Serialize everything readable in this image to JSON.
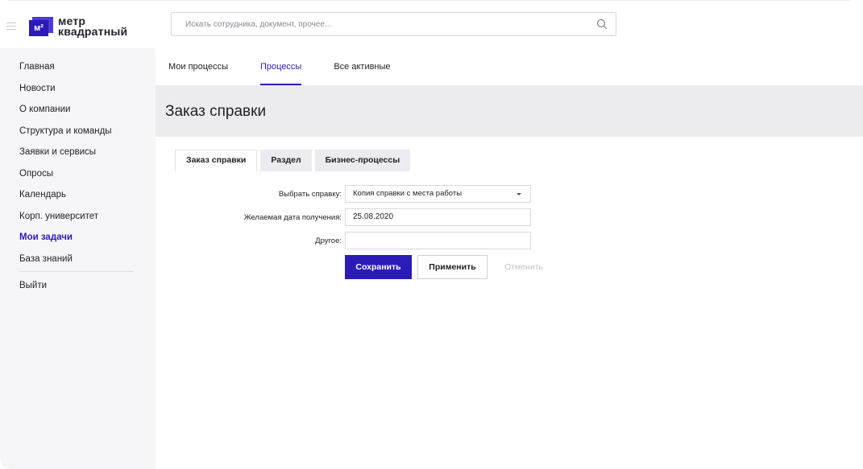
{
  "header": {
    "logo_line1": "метр",
    "logo_line2": "квадратный",
    "logo_mark": "м²",
    "search_placeholder": "Искать сотрудника, документ, прочее..."
  },
  "sidebar": {
    "items": [
      {
        "label": "Главная"
      },
      {
        "label": "Новости"
      },
      {
        "label": "О компании"
      },
      {
        "label": "Структура и команды"
      },
      {
        "label": "Заявки и сервисы"
      },
      {
        "label": "Опросы"
      },
      {
        "label": "Календарь"
      },
      {
        "label": "Корп. университет"
      },
      {
        "label": "Мои задачи"
      },
      {
        "label": "База знаний"
      }
    ],
    "logout": "Выйти"
  },
  "main": {
    "top_tabs": [
      {
        "label": "Мои процессы"
      },
      {
        "label": "Процессы"
      },
      {
        "label": "Все активные"
      }
    ],
    "page_title": "Заказ справки",
    "form_tabs": [
      {
        "label": "Заказ справки"
      },
      {
        "label": "Раздел"
      },
      {
        "label": "Бизнес-процессы"
      }
    ],
    "form": {
      "select_label": "Выбрать справку:",
      "select_value": "Копия справки с места работы",
      "date_label": "Желаемая дата получения:",
      "date_value": "25.08.2020",
      "other_label": "Другое:",
      "other_value": ""
    },
    "buttons": {
      "save": "Сохранить",
      "apply": "Применить",
      "cancel": "Отменить"
    }
  },
  "colors": {
    "accent": "#2b1bb7",
    "sidebar_bg": "#f6f6f8",
    "band_bg": "#ececf0"
  }
}
